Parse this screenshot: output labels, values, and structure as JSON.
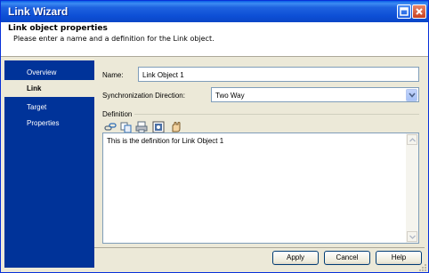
{
  "window": {
    "title": "Link Wizard",
    "accent_color": "#0a46c7",
    "nav_color": "#003399"
  },
  "header": {
    "title": "Link object properties",
    "description": "Please enter a name and a definition for the Link object."
  },
  "nav": {
    "items": [
      {
        "label": "Overview",
        "state": "normal"
      },
      {
        "label": "Link",
        "state": "selected"
      },
      {
        "label": "Target",
        "state": "link"
      },
      {
        "label": "Properties",
        "state": "link"
      }
    ]
  },
  "form": {
    "name_label": "Name:",
    "name_value": "Link Object 1",
    "sync_label": "Synchronization Direction:",
    "sync_value": "Two Way",
    "definition_label": "Definition",
    "definition_text": "This is the definition for Link Object 1"
  },
  "toolbar": {
    "icons": [
      "insert-link-icon",
      "copy-format-icon",
      "print-icon",
      "image-icon",
      "find-icon"
    ]
  },
  "buttons": {
    "apply": "Apply",
    "cancel": "Cancel",
    "help": "Help"
  }
}
